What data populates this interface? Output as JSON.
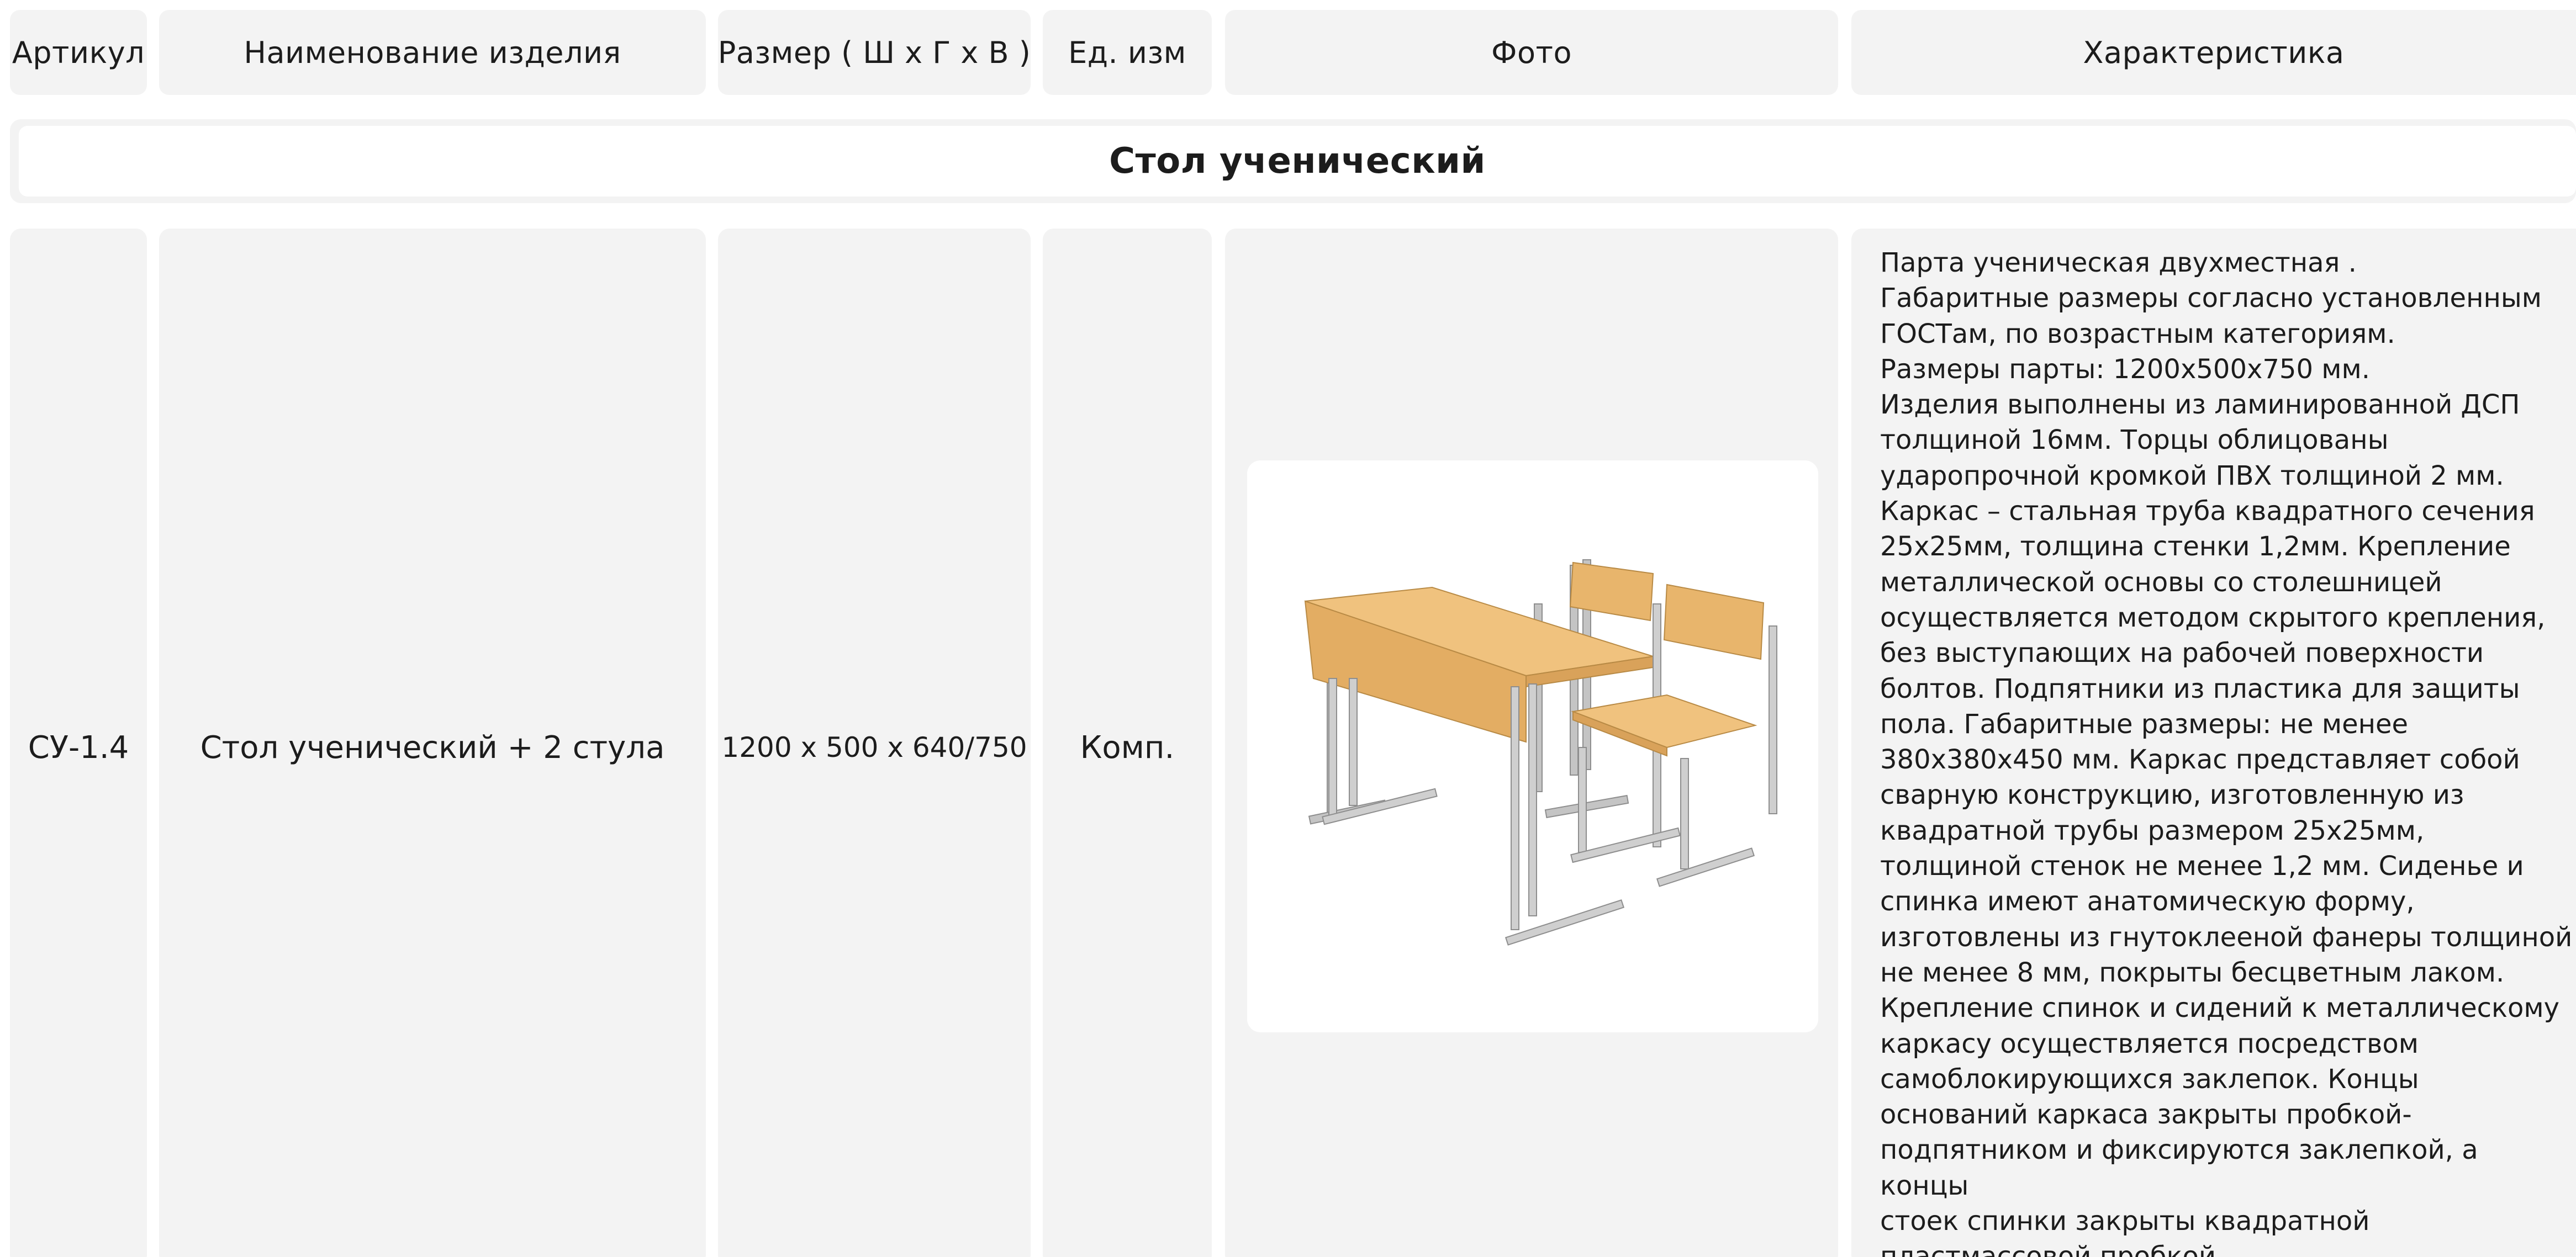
{
  "header": {
    "article": "Артикул",
    "name": "Наименование изделия",
    "size": "Размер ( Ш х Г х В )",
    "unit": "Ед. изм",
    "photo": "Фото",
    "characteristic": "Характеристика"
  },
  "section": {
    "title": "Стол ученический"
  },
  "row": {
    "article": "СУ-1.4",
    "name": "Стол ученический + 2 стула",
    "size": "1200 х 500 х 640/750",
    "unit": "Комп.",
    "photo_alt": "school-desk-with-two-chairs",
    "description": "Парта ученическая  двухместная .\nГабаритные размеры согласно установленным\nГОСТам, по возрастным категориям.\nРазмеры парты: 1200х500х750 мм.\nИзделия выполнены из ламинированной ДСП\nтолщиной 16мм. Торцы облицованы\nударопрочной кромкой ПВХ толщиной 2 мм.\nКаркас – стальная труба квадратного сечения\n25х25мм, толщина стенки 1,2мм. Крепление\nметаллической основы со столешницей\nосуществляется методом скрытого крепления,\nбез выступающих на рабочей поверхности\nболтов. Подпятники из пластика для защиты\nпола. Габаритные размеры: не менее\n380х380х450 мм. Каркас представляет собой\nсварную конструкцию, изготовленную из\nквадратной  трубы размером 25х25мм,\nтолщиной стенок не менее 1,2 мм. Сиденье и\nспинка имеют анатомическую форму,\nизготовлены из гнутоклееной фанеры толщиной\nне менее 8 мм, покрыты бесцветным лаком.\nКрепление спинок и сидений к металлическому\nкаркасу осуществляется посредством\nсамоблокирующихся заклепок. Концы\nоснований каркаса закрыты пробкой-\nподпятником и фиксируются заклепкой, а концы\nстоек спинки закрыты квадратной\nпластмассовой пробкой."
  },
  "colors": {
    "cell_bg": "#f3f3f3",
    "text": "#1c1c1c",
    "wood": "#e8b56c",
    "metal": "#bfbfbf"
  }
}
